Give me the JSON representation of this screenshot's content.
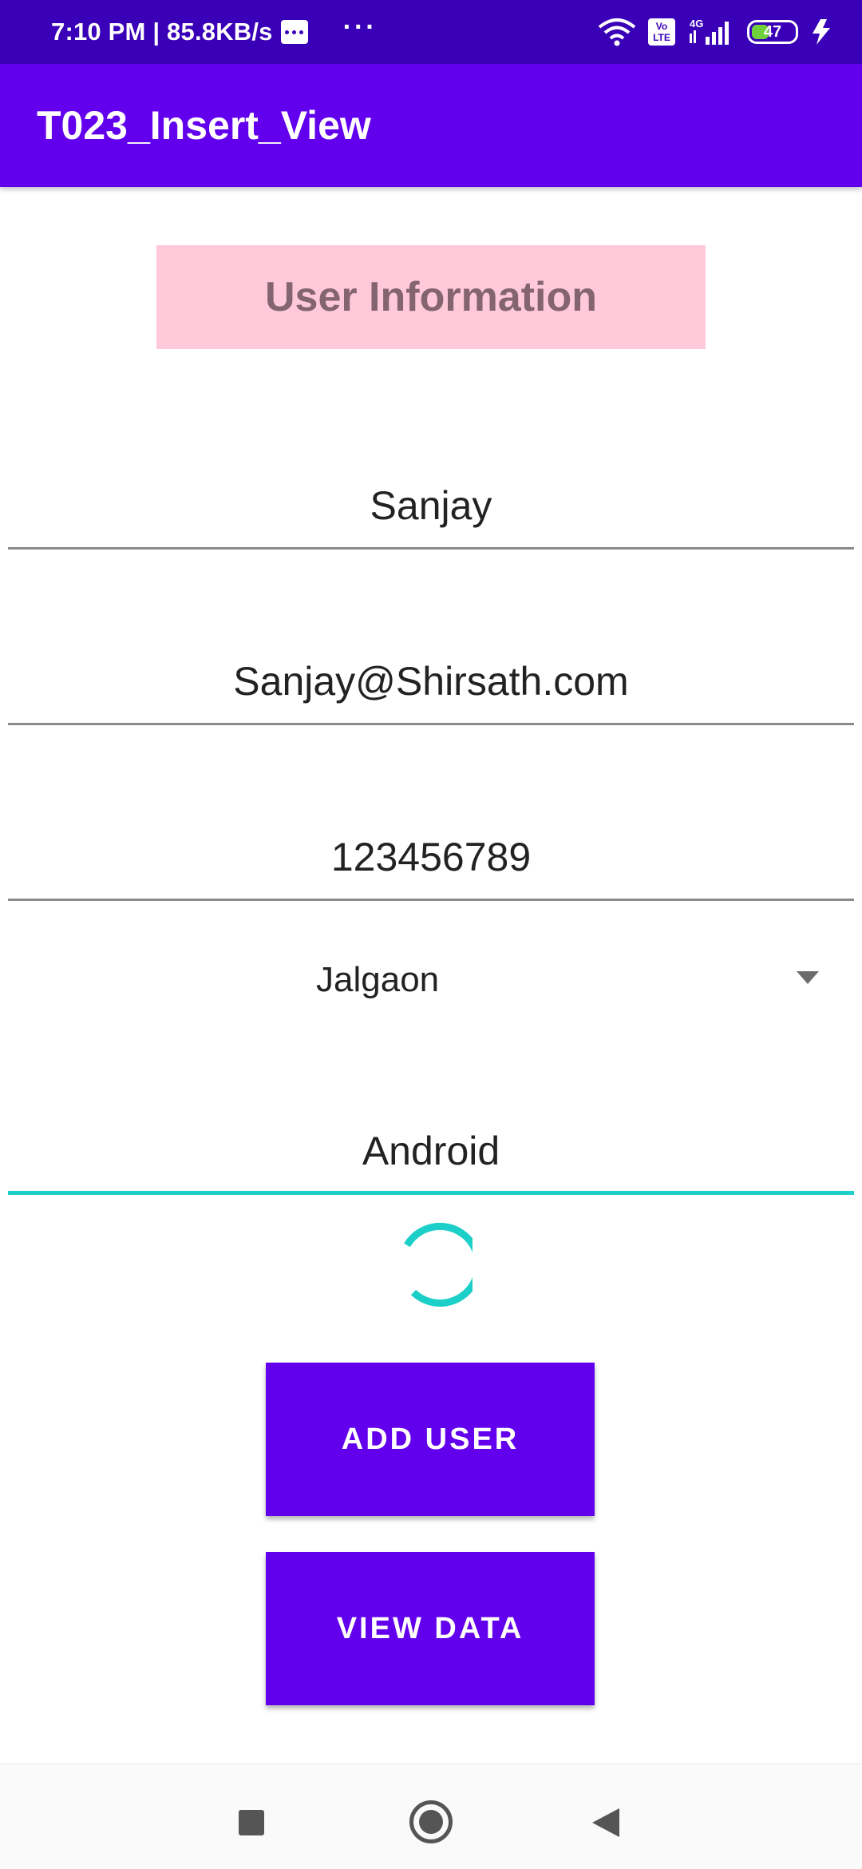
{
  "status_bar": {
    "time_speed": "7:10 PM | 85.8KB/s",
    "more": "···",
    "network_type": "4G",
    "volte_label": "Vo LTE",
    "battery_level": "47",
    "battery_fraction": 0.47
  },
  "app_bar": {
    "title": "T023_Insert_View"
  },
  "form": {
    "header": "User Information",
    "name_value": "Sanjay",
    "email_value": "Sanjay@Shirsath.com",
    "phone_value": "123456789",
    "city_selected": "Jalgaon",
    "course_value": "Android"
  },
  "buttons": {
    "add_user": "ADD USER",
    "view_data": "VIEW DATA"
  },
  "colors": {
    "status_bar": "#3a00b8",
    "primary": "#6200ee",
    "header_bg": "#ffc9d9",
    "accent": "#1ccfc9"
  },
  "nav_icons": [
    "recent-apps-icon",
    "home-icon",
    "back-icon"
  ]
}
